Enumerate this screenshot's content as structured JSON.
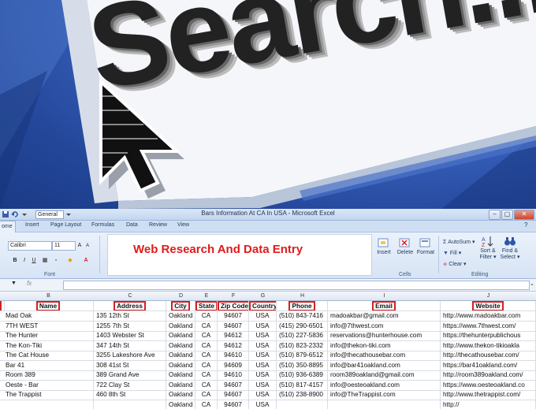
{
  "hero": {
    "search_text": "Search..."
  },
  "excel": {
    "title": "Bars Information At CA In USA - Microsoft Excel",
    "style_box": "General",
    "tabs": [
      "ome",
      "Insert",
      "Page Layout",
      "Formulas",
      "Data",
      "Review",
      "View"
    ],
    "font_name": "Calibri",
    "font_size": "11",
    "font_group": "Font",
    "banner": "Web Research And Data Entry",
    "cells_group": "Cells",
    "editing_group": "Editing",
    "buttons": {
      "insert": "Insert",
      "delete": "Delete",
      "format": "Format",
      "autosum": "AutoSum",
      "fill": "Fill",
      "clear": "Clear",
      "sort1": "Sort &",
      "sort2": "Filter",
      "find1": "Find &",
      "find2": "Select"
    },
    "columns": [
      "B",
      "C",
      "D",
      "E",
      "F",
      "G",
      "H",
      "I",
      "J"
    ],
    "headers": [
      "Name",
      "Address",
      "City",
      "State",
      "Zip Code",
      "Country",
      "Phone",
      "Email",
      "Website"
    ],
    "rows": [
      [
        "Mad Oak",
        "135 12th St",
        "Oakland",
        "CA",
        "94607",
        "USA",
        "(510) 843-7416",
        "madoakbar@gmail.com",
        "http://www.madoakbar.com"
      ],
      [
        "7TH WEST",
        "1255 7th St",
        "Oakland",
        "CA",
        "94607",
        "USA",
        "(415) 290-6501",
        "info@7thwest.com",
        "https://www.7thwest.com/"
      ],
      [
        "The Hunter",
        "1403 Webster St",
        "Oakland",
        "CA",
        "94612",
        "USA",
        "(510) 227-5836",
        "reservations@hunterhouse.com",
        "https://thehunterpublichous"
      ],
      [
        "The Kon-Tiki",
        "347 14th St",
        "Oakland",
        "CA",
        "94612",
        "USA",
        "(510) 823-2332",
        "info@thekon-tiki.com",
        "http://www.thekon-tikioakla"
      ],
      [
        "The Cat House",
        "3255 Lakeshore Ave",
        "Oakland",
        "CA",
        "94610",
        "USA",
        "(510) 879-6512",
        "info@thecathousebar.com",
        "http://thecathousebar.com/"
      ],
      [
        "Bar 41",
        "308 41st St",
        "Oakland",
        "CA",
        "94609",
        "USA",
        "(510) 350-8895",
        "info@bar41oakland.com",
        "https://bar41oakland.com/"
      ],
      [
        "Room 389",
        "389 Grand Ave",
        "Oakland",
        "CA",
        "94610",
        "USA",
        "(510) 936-6389",
        "room389oakland@gmail.com",
        "http://room389oakland.com/"
      ],
      [
        "Oeste - Bar",
        "722 Clay St",
        "Oakland",
        "CA",
        "94607",
        "USA",
        "(510) 817-4157",
        "info@oesteoakland.com",
        "https://www.oesteoakland.co"
      ],
      [
        "The Trappist",
        "460 8th St",
        "Oakland",
        "CA",
        "94607",
        "USA",
        "(510) 238-8900",
        "info@TheTrappist.com",
        "http://www.thetrappist.com/"
      ],
      [
        "",
        "",
        "Oakland",
        "CA",
        "94607",
        "USA",
        "",
        "",
        "http://"
      ]
    ]
  }
}
